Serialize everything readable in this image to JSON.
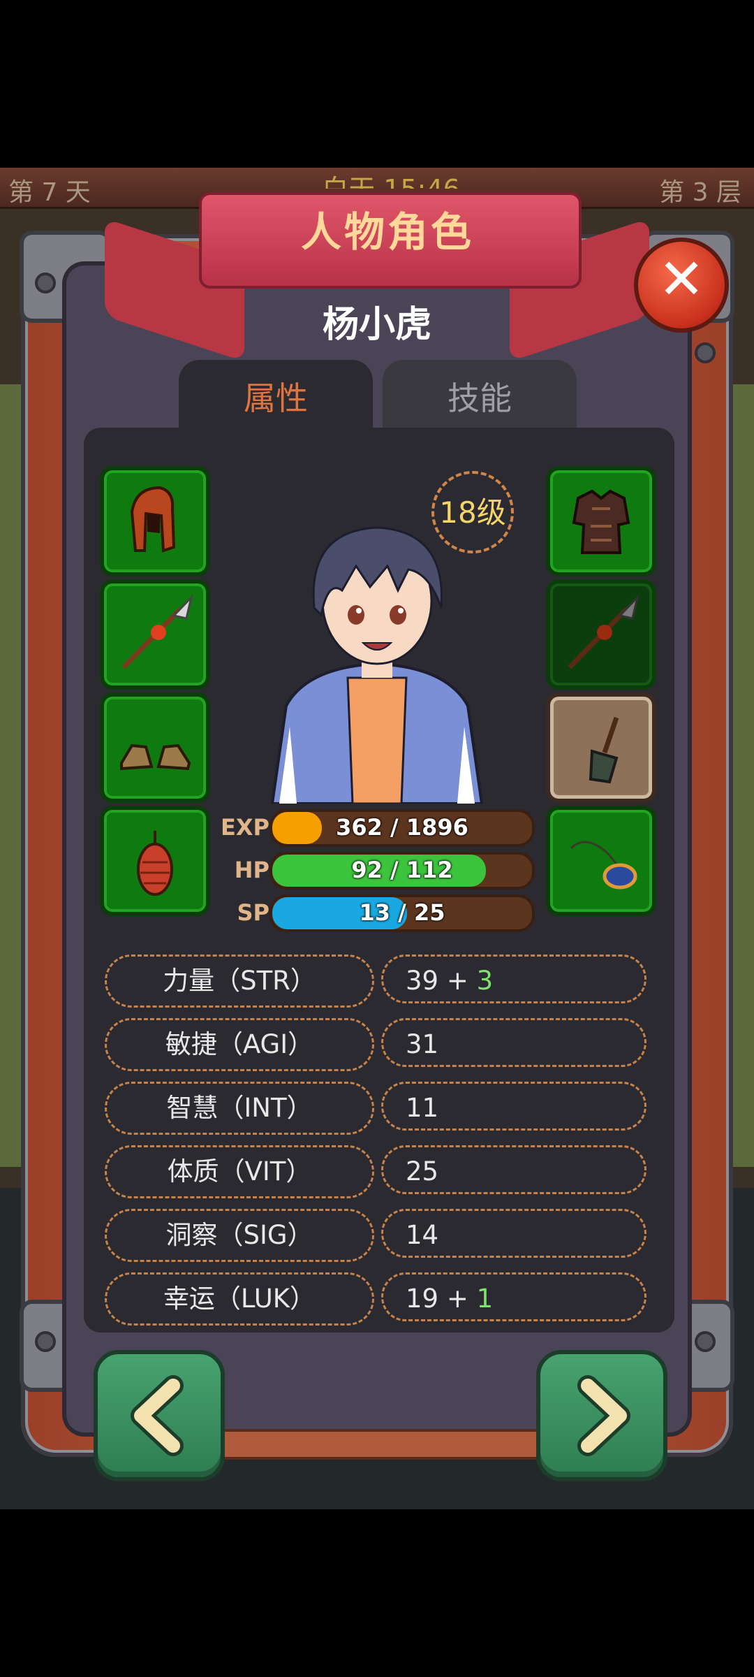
{
  "status_bar": {
    "day": "第 7 天",
    "time": "白天 15:46",
    "floor": "第 3 层"
  },
  "dialog": {
    "title": "人物角色",
    "close_icon": "close-icon"
  },
  "character": {
    "name": "杨小虎",
    "level": "18级"
  },
  "tabs": [
    {
      "label": "属性",
      "active": true
    },
    {
      "label": "技能",
      "active": false
    }
  ],
  "equipment": {
    "left": [
      {
        "slot": "helmet",
        "icon": "helmet-icon"
      },
      {
        "slot": "weapon",
        "icon": "spear-icon"
      },
      {
        "slot": "boots",
        "icon": "boots-icon"
      },
      {
        "slot": "accessory",
        "icon": "pinecone-charm-icon"
      }
    ],
    "right": [
      {
        "slot": "armor",
        "icon": "armor-icon"
      },
      {
        "slot": "offhand",
        "icon": "spear-icon"
      },
      {
        "slot": "tool",
        "icon": "shovel-icon"
      },
      {
        "slot": "amulet",
        "icon": "amulet-icon"
      }
    ]
  },
  "bars": {
    "exp": {
      "label": "EXP",
      "text": "362 / 1896",
      "current": 362,
      "max": 1896,
      "color": "#f5a000"
    },
    "hp": {
      "label": "HP",
      "text": "92 / 112",
      "current": 92,
      "max": 112,
      "color": "#3cc43c"
    },
    "sp": {
      "label": "SP",
      "text": "13 / 25",
      "current": 13,
      "max": 25,
      "color": "#19a8e0"
    }
  },
  "stats": [
    {
      "label": "力量（STR）",
      "base": "39",
      "plus": " + ",
      "bonus": "3"
    },
    {
      "label": "敏捷（AGI）",
      "base": "31",
      "plus": "",
      "bonus": ""
    },
    {
      "label": "智慧（INT）",
      "base": "11",
      "plus": "",
      "bonus": ""
    },
    {
      "label": "体质（VIT）",
      "base": "25",
      "plus": "",
      "bonus": ""
    },
    {
      "label": "洞察（SIG）",
      "base": "14",
      "plus": "",
      "bonus": ""
    },
    {
      "label": "幸运（LUK）",
      "base": "19",
      "plus": " + ",
      "bonus": "1"
    }
  ],
  "nav": {
    "prev_icon": "chevron-left-icon",
    "next_icon": "chevron-right-icon"
  }
}
